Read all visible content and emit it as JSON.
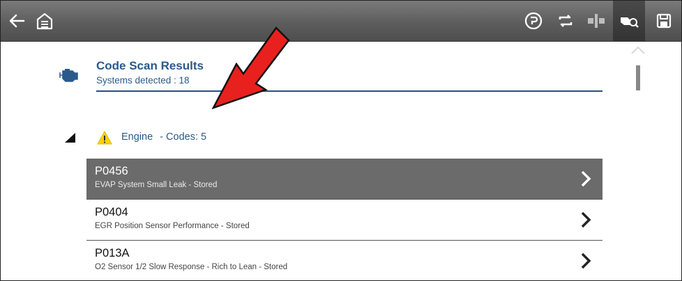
{
  "header": {
    "title": "Code Scan Results",
    "subtitle": "Systems detected : 18"
  },
  "toolbar": {
    "buttons": [
      {
        "name": "back-arrow-icon"
      },
      {
        "name": "home-icon"
      },
      {
        "name": "help-icon"
      },
      {
        "name": "refresh-icon"
      },
      {
        "name": "split-icon"
      },
      {
        "name": "vehicle-scan-icon",
        "active": true
      },
      {
        "name": "save-icon"
      }
    ]
  },
  "system": {
    "name": "Engine",
    "codes_label": "- Codes: 5"
  },
  "codes": [
    {
      "code": "P0456",
      "description": "EVAP System Small Leak - Stored",
      "selected": true
    },
    {
      "code": "P0404",
      "description": "EGR Position Sensor Performance - Stored",
      "selected": false
    },
    {
      "code": "P013A",
      "description": "O2 Sensor 1/2 Slow Response - Rich to Lean - Stored",
      "selected": false
    }
  ],
  "colors": {
    "accent": "#2a5a8c",
    "selected_row": "#6b6b6b",
    "annotation_arrow": "#e8211e",
    "warning": "#ffd400"
  }
}
